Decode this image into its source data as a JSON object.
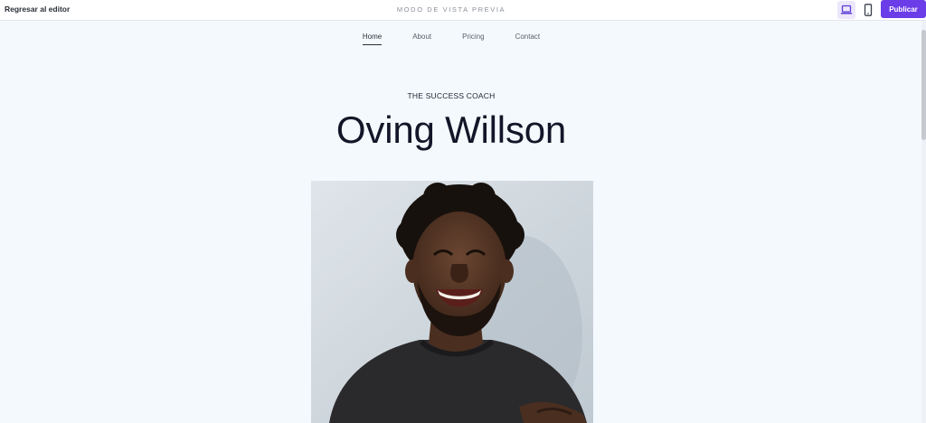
{
  "toolbar": {
    "back_label": "Regresar al editor",
    "mode_label": "MODO DE VISTA PREVIA",
    "devices": [
      {
        "label": "desktop",
        "icon": "laptop-icon",
        "selected": true
      },
      {
        "label": "mobile",
        "icon": "phone-icon",
        "selected": false
      }
    ],
    "publish_label": "Publicar",
    "accent_color": "#6b3de8"
  },
  "site": {
    "nav": [
      {
        "label": "Home",
        "active": true
      },
      {
        "label": "About",
        "active": false
      },
      {
        "label": "Pricing",
        "active": false
      },
      {
        "label": "Contact",
        "active": false
      }
    ],
    "eyebrow": "THE SUCCESS COACH",
    "title": "Oving Willson",
    "background_color": "#f4f9fd"
  }
}
